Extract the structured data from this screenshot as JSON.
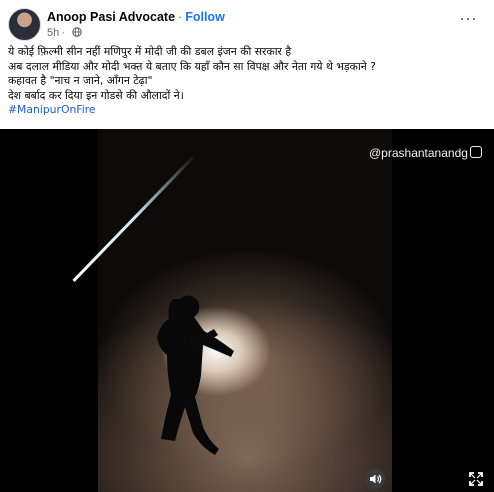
{
  "post": {
    "author": "Anoop Pasi Advocate",
    "separator": "·",
    "follow_label": "Follow",
    "time": "5h",
    "more_label": "···",
    "text_lines": [
      "ये कोई फ़िल्मी सीन नहीं मणिपुर में मोदी जी की डबल इंजन की सरकार है",
      "अब दलाल मीडिया और मोदी भक्त ये बताए कि यहाँ कौन सा विपक्ष और नेता गये थे भड़काने ?",
      "कहावत है \"नाच न जाने, आँगन टेढ़ा\"",
      "देश बर्बाद कर दिया इन गोडसे की औलादों ने।"
    ],
    "hashtag": "#ManipurOnFire"
  },
  "video": {
    "watermark": "@prashantanandg"
  },
  "icons": {
    "avatar": "profile-avatar",
    "privacy": "globe-icon",
    "more": "more-options-icon",
    "sound": "sound-icon",
    "fullscreen": "expand-icon"
  },
  "colors": {
    "link": "#1877f2",
    "hashtag": "#1a5fc4",
    "text": "#050505",
    "secondary": "#65676b"
  }
}
